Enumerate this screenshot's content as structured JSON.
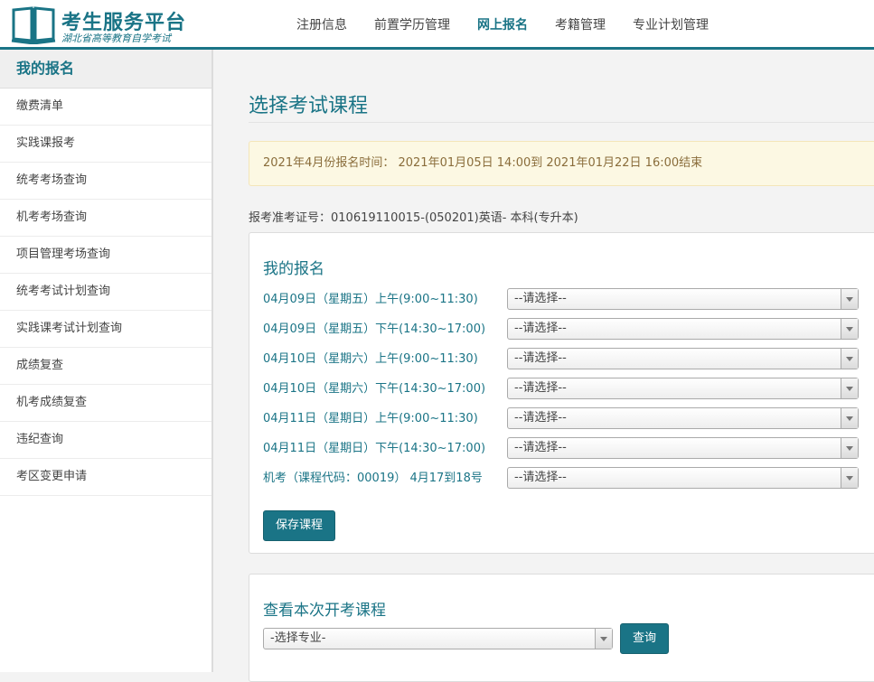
{
  "header": {
    "logo_title": "考生服务平台",
    "logo_subtitle": "湖北省高等教育自学考试",
    "nav": [
      {
        "label": "注册信息",
        "active": false
      },
      {
        "label": "前置学历管理",
        "active": false
      },
      {
        "label": "网上报名",
        "active": true
      },
      {
        "label": "考籍管理",
        "active": false
      },
      {
        "label": "专业计划管理",
        "active": false
      }
    ]
  },
  "sidebar": {
    "title": "我的报名",
    "items": [
      {
        "label": "缴费清单"
      },
      {
        "label": "实践课报考"
      },
      {
        "label": "统考考场查询"
      },
      {
        "label": "机考考场查询"
      },
      {
        "label": "项目管理考场查询"
      },
      {
        "label": "统考考试计划查询"
      },
      {
        "label": "实践课考试计划查询"
      },
      {
        "label": "成绩复查"
      },
      {
        "label": "机考成绩复查"
      },
      {
        "label": "违纪查询"
      },
      {
        "label": "考区变更申请"
      }
    ]
  },
  "main": {
    "page_title": "选择考试课程",
    "notice": "2021年4月份报名时间： 2021年01月05日 14:00到 2021年01月22日 16:00结束",
    "exam_info": "报考准考证号：010619110015-(050201)英语- 本科(专升本)",
    "registration": {
      "title": "我的报名",
      "rows": [
        {
          "label": "04月09日（星期五）上午(9:00~11:30)",
          "value": "--请选择--"
        },
        {
          "label": "04月09日（星期五）下午(14:30~17:00)",
          "value": "--请选择--"
        },
        {
          "label": "04月10日（星期六）上午(9:00~11:30)",
          "value": "--请选择--"
        },
        {
          "label": "04月10日（星期六）下午(14:30~17:00)",
          "value": "--请选择--"
        },
        {
          "label": "04月11日（星期日）上午(9:00~11:30)",
          "value": "--请选择--"
        },
        {
          "label": "04月11日（星期日）下午(14:30~17:00)",
          "value": "--请选择--"
        },
        {
          "label": "机考（课程代码：00019） 4月17到18号",
          "value": "--请选择--"
        }
      ],
      "save_label": "保存课程"
    },
    "courses": {
      "title": "查看本次开考课程",
      "select_value": "-选择专业-",
      "query_label": "查询"
    }
  },
  "colors": {
    "accent": "#1a7486",
    "notice_bg": "#fcf8e3",
    "notice_text": "#8a6d3b"
  }
}
